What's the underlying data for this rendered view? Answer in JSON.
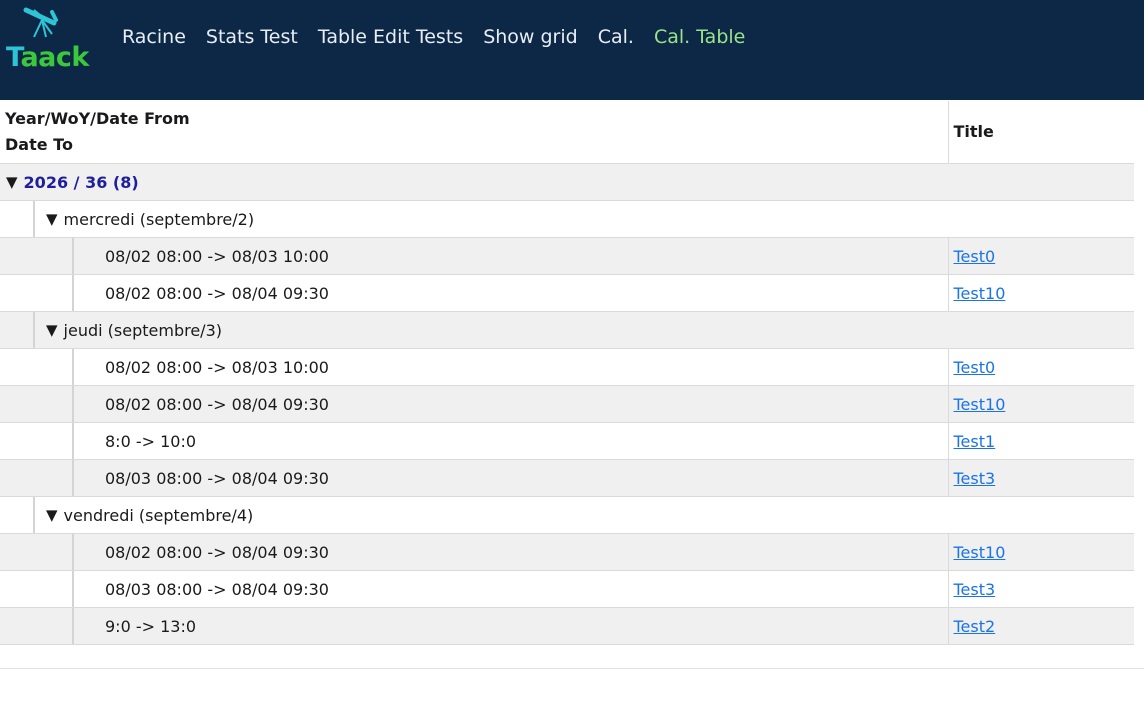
{
  "nav": {
    "logo_text": "Taack",
    "items": [
      "Racine",
      "Stats Test",
      "Table Edit Tests",
      "Show grid",
      "Cal.",
      "Cal. Table"
    ],
    "active_index": 5
  },
  "table": {
    "header": {
      "col1_line1": "Year/WoY/Date From",
      "col1_line2": "Date To",
      "col2": "Title"
    },
    "group": {
      "toggle": "▼",
      "label": "2026 / 36 (8)"
    },
    "days": [
      {
        "toggle": "▼",
        "label": "mercredi (septembre/2)",
        "rows": [
          {
            "dates": "08/02 08:00 -> 08/03 10:00",
            "title": "Test0"
          },
          {
            "dates": "08/02 08:00 -> 08/04 09:30",
            "title": "Test10"
          }
        ]
      },
      {
        "toggle": "▼",
        "label": "jeudi (septembre/3)",
        "rows": [
          {
            "dates": "08/02 08:00 -> 08/03 10:00",
            "title": "Test0"
          },
          {
            "dates": "08/02 08:00 -> 08/04 09:30",
            "title": "Test10"
          },
          {
            "dates": "8:0 -> 10:0",
            "title": "Test1"
          },
          {
            "dates": "08/03 08:00 -> 08/04 09:30",
            "title": "Test3"
          }
        ]
      },
      {
        "toggle": "▼",
        "label": "vendredi (septembre/4)",
        "rows": [
          {
            "dates": "08/02 08:00 -> 08/04 09:30",
            "title": "Test10"
          },
          {
            "dates": "08/03 08:00 -> 08/04 09:30",
            "title": "Test3"
          },
          {
            "dates": "9:0 -> 13:0",
            "title": "Test2"
          }
        ]
      }
    ]
  },
  "colors": {
    "navbar_bg": "#0c2846",
    "nav_active": "#9be38a",
    "logo_teal": "#2ec4d6",
    "logo_green": "#3cc83c",
    "group_label": "#1f1f9e",
    "link": "#1a73e8",
    "row_alt": "#f0f0f0"
  },
  "icons": {
    "logo": "telescope-icon",
    "toggle": "triangle-down-icon"
  }
}
